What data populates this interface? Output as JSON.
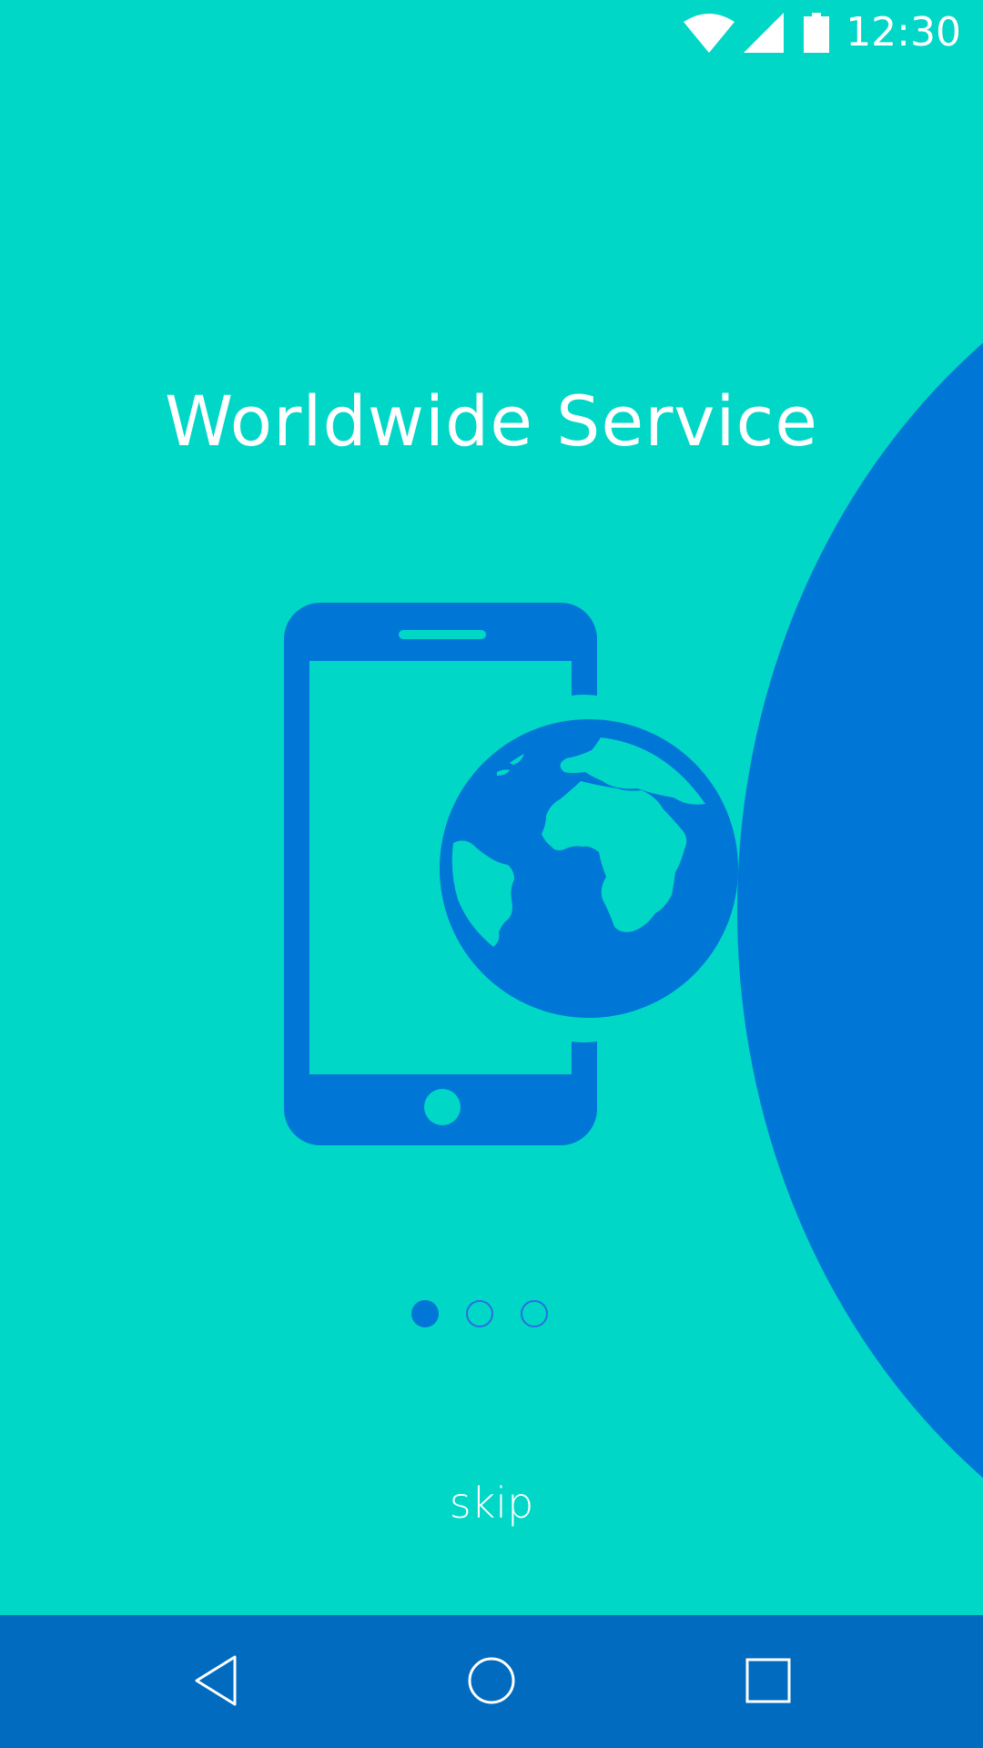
{
  "status_bar": {
    "time": "12:30",
    "icons": [
      "wifi-icon",
      "cellular-signal-icon",
      "battery-icon"
    ]
  },
  "onboarding": {
    "title": "Worldwide Service",
    "illustration": "phone-globe-icon",
    "page_indicator": {
      "total": 3,
      "current": 1
    },
    "skip_label": "skip"
  },
  "nav_bar": {
    "buttons": [
      "back-icon",
      "home-icon",
      "recents-icon"
    ]
  },
  "colors": {
    "background": "#00d7c7",
    "accent": "#0076d6",
    "nav_bar": "#006bbf",
    "text": "#ffffff"
  }
}
